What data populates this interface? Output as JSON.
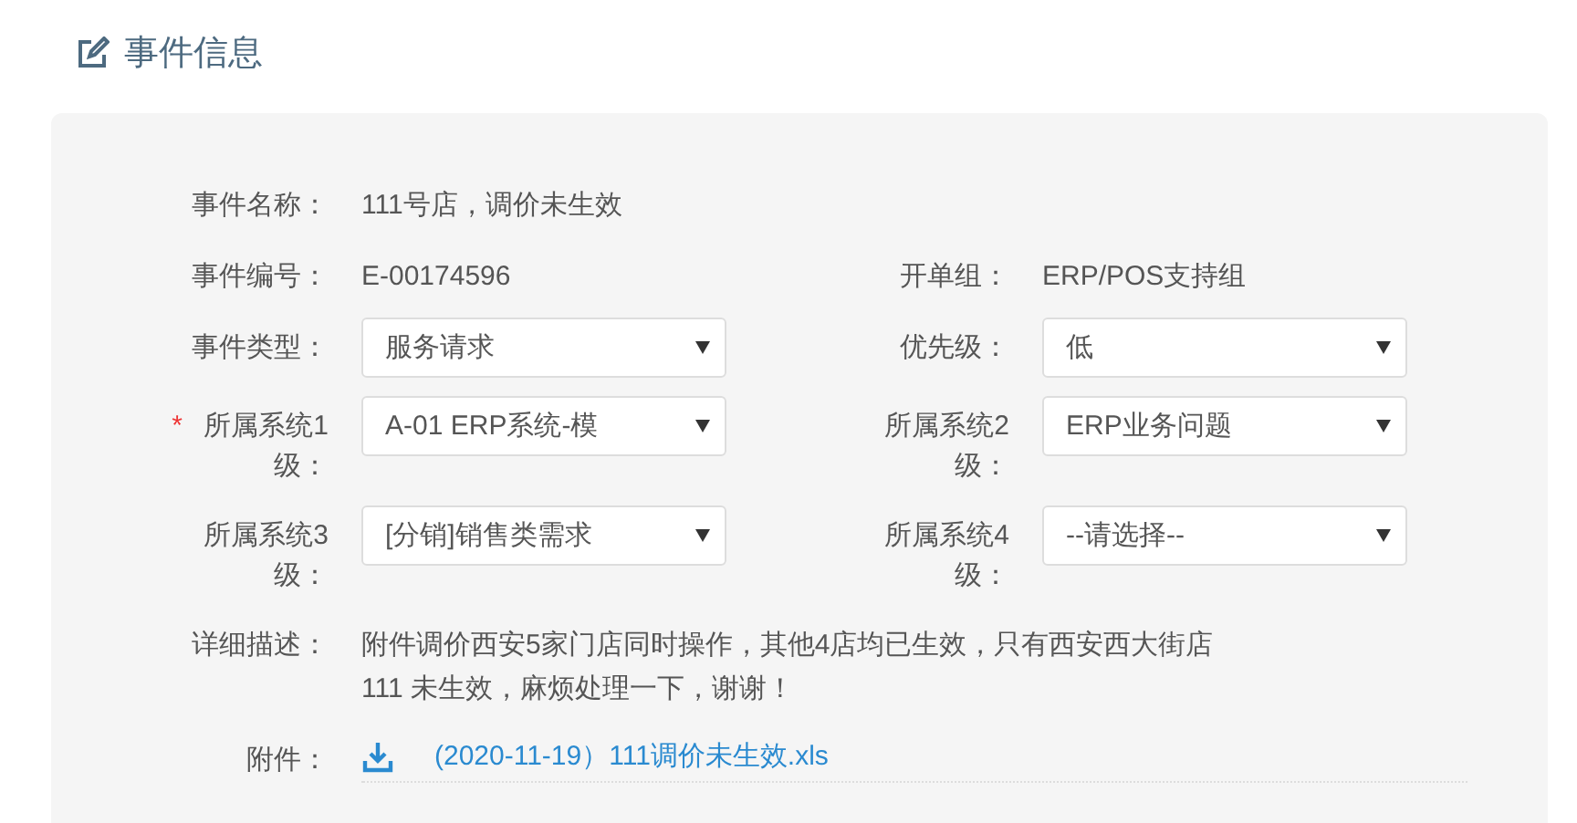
{
  "section": {
    "title": "事件信息"
  },
  "rows": [
    [
      {
        "kind": "text",
        "label": "事件名称：",
        "value": "111号店，调价未生效"
      }
    ],
    [
      {
        "kind": "text",
        "label": "事件编号：",
        "value": "E-00174596"
      },
      {
        "kind": "text",
        "label": "开单组：",
        "value": "ERP/POS支持组"
      }
    ],
    [
      {
        "kind": "select",
        "label": "事件类型：",
        "value": "服务请求"
      },
      {
        "kind": "select",
        "label": "优先级：",
        "value": "低"
      }
    ],
    [
      {
        "kind": "select",
        "marker": "*",
        "label": "所属系统1级：",
        "value": "A-01 ERP系统-模"
      },
      {
        "kind": "select",
        "label": "所属系统2级：",
        "value": "ERP业务问题"
      }
    ],
    [
      {
        "kind": "select",
        "label": "所属系统3级：",
        "value": "[分销]销售类需求"
      },
      {
        "kind": "select",
        "label": "所属系统4级：",
        "value": "--请选择--"
      }
    ],
    [
      {
        "kind": "text",
        "label": "详细描述：",
        "value": "附件调价西安5家门店同时操作，其他4店均已生效，只有西安西大街店\n111 未生效，麻烦处理一下，谢谢！"
      }
    ],
    [
      {
        "kind": "file",
        "label": "附件：",
        "value": "(2020-11-19）111调价未生效.xls"
      }
    ]
  ]
}
